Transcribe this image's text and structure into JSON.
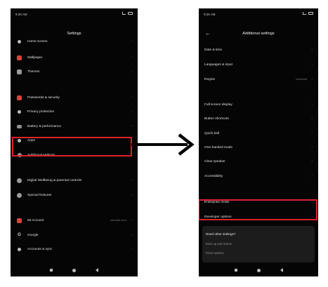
{
  "left_screen": {
    "status_time": "9:25 AM",
    "title": "Settings",
    "items": [
      {
        "label": "Home screen",
        "icon": "home-icon"
      },
      {
        "label": "Wallpaper",
        "icon": "wallpaper-icon"
      },
      {
        "label": "Themes",
        "icon": "themes-icon"
      },
      {
        "label": "Passwords & security",
        "icon": "lock-icon"
      },
      {
        "label": "Privacy protection",
        "icon": "privacy-icon"
      },
      {
        "label": "Battery & performance",
        "icon": "battery-icon"
      },
      {
        "label": "Apps",
        "icon": "apps-icon"
      },
      {
        "label": "Additional settings",
        "icon": "more-icon"
      },
      {
        "label": "Digital Wellbeing & parental controls",
        "icon": "wellbeing-icon"
      },
      {
        "label": "Special features",
        "icon": "special-features-icon"
      },
      {
        "label": "Mi Account",
        "icon": "mi-account-icon",
        "value": "mirexdsk.xnne"
      },
      {
        "label": "Google",
        "icon": "google-icon"
      },
      {
        "label": "Accounts & sync",
        "icon": "accounts-icon"
      }
    ]
  },
  "right_screen": {
    "status_time": "9:25 AM",
    "title": "Additional settings",
    "items": [
      {
        "label": "Date & time"
      },
      {
        "label": "Languages & input"
      },
      {
        "label": "Region",
        "value": "Indonesia"
      },
      {
        "label": "Full screen display"
      },
      {
        "label": "Button shortcuts"
      },
      {
        "label": "Quick ball"
      },
      {
        "label": "One-handed mode"
      },
      {
        "label": "Clear speaker"
      },
      {
        "label": "Accessibility"
      },
      {
        "label": "Enterprise mode"
      },
      {
        "label": "Developer options"
      }
    ],
    "sheet": {
      "title": "Need other settings?",
      "rows": [
        "Back up and restore",
        "Reset options"
      ]
    }
  },
  "highlight_color": "#d9232a"
}
